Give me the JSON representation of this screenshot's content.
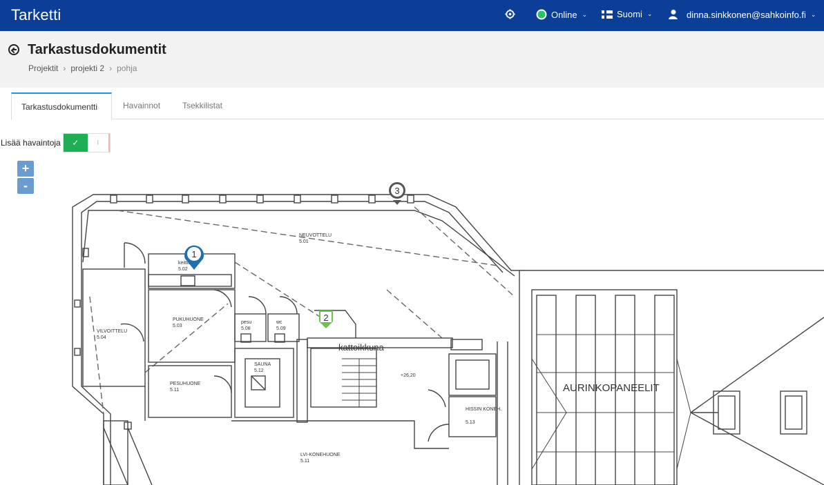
{
  "app": {
    "brand": "Tarketti"
  },
  "topbar": {
    "settings_icon": "gear-icon",
    "status_label": "Online",
    "language_label": "Suomi",
    "user_email": "dinna.sinkkonen@sahkoinfo.fi",
    "status_color": "#29c46a"
  },
  "page": {
    "title": "Tarkastusdokumentit",
    "breadcrumb": [
      "Projektit",
      "projekti 2",
      "pohja"
    ]
  },
  "tabs": [
    {
      "label": "Tarkastusdokumentti",
      "active": true
    },
    {
      "label": "Havainnot",
      "active": false
    },
    {
      "label": "Tsekkilistat",
      "active": false
    }
  ],
  "observations": {
    "label": "Lisää havaintoja",
    "toggle_on": "✓",
    "toggle_off": "I"
  },
  "zoom": {
    "in": "+",
    "out": "-"
  },
  "plan": {
    "rooms": [
      {
        "name": "NEUVOTTELU",
        "code": "5.01"
      },
      {
        "name": "keittiö",
        "code": "5.02"
      },
      {
        "name": "PUKUHUONE",
        "code": "5.03"
      },
      {
        "name": "VILVOITTELU",
        "code": "5.04"
      },
      {
        "name": "pesu",
        "code": "5.08"
      },
      {
        "name": "wc",
        "code": "5.09"
      },
      {
        "name": "SAUNA",
        "code": "5.12"
      },
      {
        "name": "PESUHUONE",
        "code": "5.11"
      },
      {
        "name": "HISSIN KONEH.",
        "code": "5.13"
      },
      {
        "name": "LVI-KONEHUONE",
        "code": "5.11"
      }
    ],
    "labels": {
      "skylight": "kattoikkuna",
      "solar": "AURINKOPANEELIT",
      "elevation": "+26,20"
    },
    "markers": [
      {
        "number": "1",
        "color": "#1f6fb0"
      },
      {
        "number": "2",
        "color": "#6cc24a"
      },
      {
        "number": "3",
        "color": "#555555"
      }
    ]
  }
}
